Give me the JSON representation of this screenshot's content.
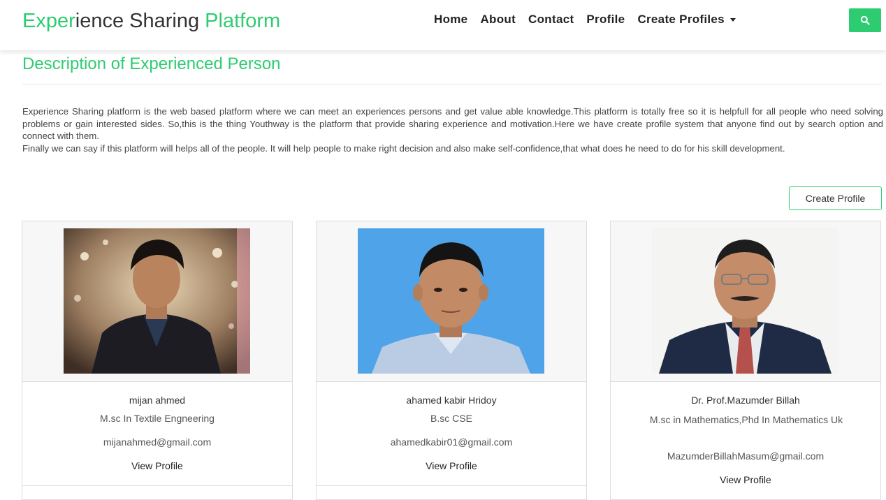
{
  "brand": {
    "part1": "Exper",
    "part2": "ience Sharing ",
    "part3": "Platform"
  },
  "nav": {
    "home": "Home",
    "about": "About",
    "contact": "Contact",
    "profile": "Profile",
    "create_profiles": "Create Profiles"
  },
  "search": {
    "icon": "search-icon"
  },
  "page": {
    "title": "Description of Experienced Person",
    "paragraph1": "Experience Sharing platform is the web based platform where we can meet an experiences persons and get value able knowledge.This platform is totally free so it is helpfull for all people who need solving problems or gain interested sides. So,this is the thing Youthway is the platform that provide sharing experience and motivation.Here we have create profile system that anyone find out by search option and connect with them.",
    "paragraph2": "Finally we can say if this platform will helps all of the people. It will help people to make right decision and also make self-confidence,that what does he need to do for his skill development.",
    "create_profile_label": "Create Profile"
  },
  "profiles": [
    {
      "name": "mijan ahmed",
      "qualification": "M.sc In Textile Engneering",
      "email": "mijanahmed@gmail.com",
      "view_label": "View Profile"
    },
    {
      "name": "ahamed kabir Hridoy",
      "qualification": "B.sc CSE",
      "email": "ahamedkabir01@gmail.com",
      "view_label": "View Profile"
    },
    {
      "name": "Dr. Prof.Mazumder Billah",
      "qualification": "M.sc in Mathematics,Phd In Mathematics Uk",
      "email": "MazumderBillahMasum@gmail.com",
      "view_label": "View Profile"
    }
  ],
  "colors": {
    "accent": "#2ecc71",
    "text": "#333333",
    "border": "#dddddd"
  }
}
